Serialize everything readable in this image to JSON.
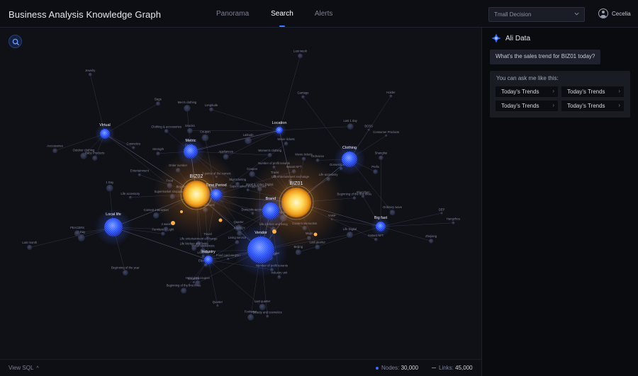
{
  "app": {
    "title": "Business Analysis Knowledge Graph"
  },
  "nav": {
    "tabs": [
      {
        "label": "Panorama"
      },
      {
        "label": "Search"
      },
      {
        "label": "Alerts"
      }
    ],
    "active": "Search"
  },
  "scope_select": {
    "value": "Tmall Decision"
  },
  "user": {
    "name": "Cecelia"
  },
  "footer": {
    "view_sql": "View SQL",
    "nodes_label": "Nodes:",
    "nodes_value": "30,000",
    "links_label": "Links:",
    "links_value": "45,000"
  },
  "assistant": {
    "name": "Ali Data",
    "user_message": "What’s the sales trend for BIZ01 today?",
    "suggest_title": "You can ask me like this:",
    "suggestions": [
      {
        "label": "Today's Trends"
      },
      {
        "label": "Today's Trends"
      },
      {
        "label": "Today's Trends"
      },
      {
        "label": "Today's Trends"
      }
    ]
  },
  "colors": {
    "accent": "#3d7cff",
    "hub_gold": "#ffd25a",
    "node_blue": "#2f5cff",
    "background": "#101117"
  },
  "graph": {
    "hubs": [
      {
        "label": "BIZ02",
        "kind": "gold"
      },
      {
        "label": "BIZ01",
        "kind": "gold"
      },
      {
        "label": "Vendor",
        "kind": "blue"
      },
      {
        "label": "Local life",
        "kind": "blue"
      },
      {
        "label": "Clothing",
        "kind": "blue"
      },
      {
        "label": "Metric",
        "kind": "blue"
      },
      {
        "label": "Virtual",
        "kind": "blue"
      },
      {
        "label": "Location",
        "kind": "blue"
      },
      {
        "label": "Big fast",
        "kind": "blue"
      },
      {
        "label": "Brand",
        "kind": "blue"
      },
      {
        "label": "Industry",
        "kind": "blue"
      },
      {
        "label": "Time Period",
        "kind": "blue"
      }
    ],
    "minor_labels": [
      "Life accessory",
      "Life entertainment exchange",
      "Life kitchen and living",
      "Content interaction",
      "Order number",
      "Local life",
      "Entertainment",
      "Living service",
      "Quarter",
      "Last quarter",
      "Number of profit tenants",
      "Beginning of the first three",
      "Supermarket shopping card",
      "Movie tickets",
      "Instant NFT",
      "Domestic service",
      "Coupon",
      "Travel",
      "Food card coupon",
      "Hotel card coupon",
      "Maps",
      "Water appliances",
      "Electronics",
      "Beauty and cosmetics",
      "Footwear",
      "Life Digital",
      "Book & Video Digital",
      "Furniture & Light",
      "Beginning of the year",
      "1 Day",
      "3 week",
      "5 Day",
      "Last month",
      "PEACERS",
      "Consumer Products",
      "Ordinary wave",
      "Carriage",
      "BOSS",
      "Prefix",
      "Holder",
      "Ordnance",
      "Strength",
      "Beginning of this quarter - Now",
      "3 points of the current",
      "Clothing & accessories",
      "Skyrocketing",
      "Women's clothing",
      "Men's clothing",
      "Jewelry",
      "Outdoor clothing",
      "Cosmetics",
      "Baby Products",
      "Accessories",
      "Bags",
      "Food",
      "Snacks",
      "Fresh",
      "Appliances",
      "Last week",
      "Last 1 day",
      "Latitude",
      "Longitude",
      "Shanghai",
      "Beijing",
      "Zhejiang",
      "Hangzhou",
      "Shenzhen",
      "YARP",
      "DEP",
      "FALBOY",
      "Industry unit"
    ]
  }
}
